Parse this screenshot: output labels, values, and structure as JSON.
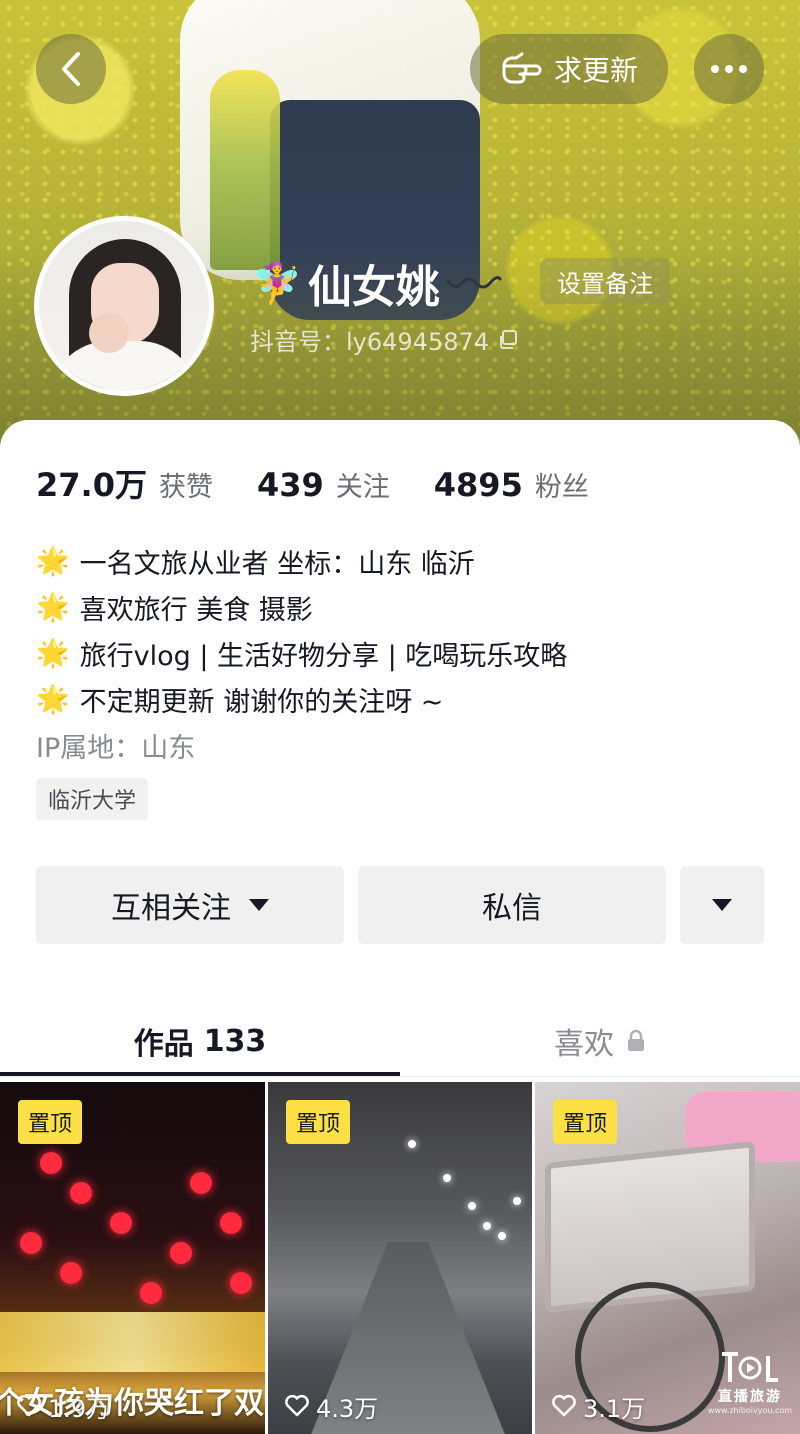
{
  "header": {
    "update_label": "求更新",
    "name": "仙女姚",
    "name_emoji": "🧚‍♀️",
    "remark_label": "设置备注",
    "douyin_id": "抖音号：ly64945874"
  },
  "stats": [
    {
      "num": "27.0万",
      "label": "获赞"
    },
    {
      "num": "439",
      "label": "关注"
    },
    {
      "num": "4895",
      "label": "粉丝"
    }
  ],
  "bio": {
    "star": "🌟",
    "lines": [
      "一名文旅从业者 坐标：山东 临沂",
      "喜欢旅行 美食 摄影",
      "旅行vlog | 生活好物分享 | 吃喝玩乐攻略",
      "不定期更新 谢谢你的关注呀 ~"
    ],
    "ip": "IP属地：山东",
    "tag": "临沂大学"
  },
  "actions": {
    "follow_label": "互相关注",
    "message_label": "私信"
  },
  "tabs": {
    "works_label": "作品",
    "works_count": "133",
    "likes_label": "喜欢"
  },
  "videos": [
    {
      "pin": "置顶",
      "caption": "个女孩为你哭红了双",
      "likes": "1.9万"
    },
    {
      "pin": "置顶",
      "caption": "",
      "likes": "4.3万"
    },
    {
      "pin": "置顶",
      "caption": "",
      "likes": "3.1万"
    }
  ],
  "watermark": {
    "text": "直播旅游",
    "url": "www.zhiboivyou.com"
  },
  "colors": {
    "pin_yellow": "#fde046",
    "banner_yellow": "#c8c43a",
    "text_primary": "#161823",
    "text_secondary": "#8a8b91"
  }
}
